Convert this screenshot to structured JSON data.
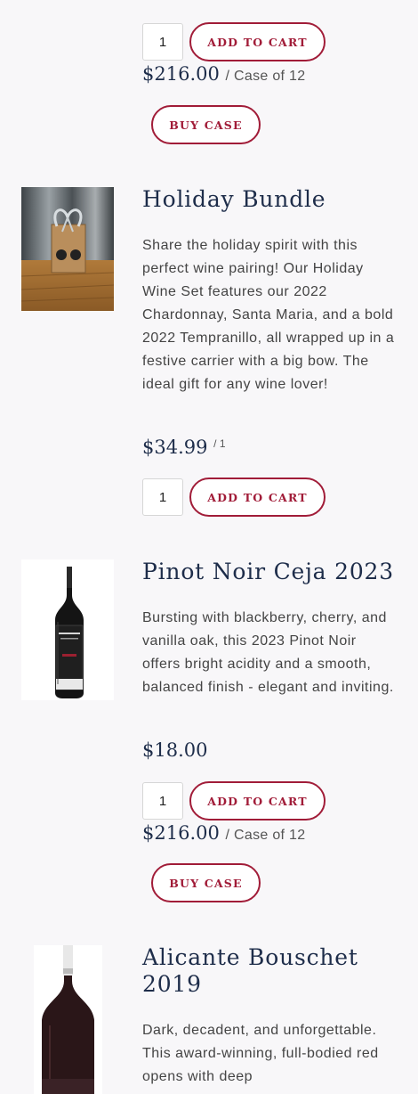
{
  "products": [
    {
      "name": "",
      "quantity": "1",
      "add_to_cart_label": "ADD TO CART",
      "case_price": "$216.00",
      "case_unit": "/ Case of 12",
      "buy_case_label": "BUY CASE"
    },
    {
      "name": "Holiday Bundle",
      "description": "Share the holiday spirit with this perfect wine pairing! Our Holiday Wine Set features our 2022 Chardonnay, Santa Maria, and a bold 2022 Tempranillo, all wrapped up in a festive carrier with a big bow. The ideal gift for any wine lover!",
      "price": "$34.99",
      "price_unit": "/ 1",
      "quantity": "1",
      "add_to_cart_label": "ADD TO CART"
    },
    {
      "name": "Pinot Noir Ceja 2023",
      "description": "Bursting with blackberry, cherry, and vanilla oak, this 2023 Pinot Noir offers bright acidity and a smooth, balanced finish - elegant and inviting.",
      "price": "$18.00",
      "quantity": "1",
      "add_to_cart_label": "ADD TO CART",
      "case_price": "$216.00",
      "case_unit": "/ Case of 12",
      "buy_case_label": "BUY CASE"
    },
    {
      "name": "Alicante Bouschet 2019",
      "description": "Dark, decadent, and unforgettable. This award-winning, full-bodied red opens with deep"
    }
  ],
  "colors": {
    "accent": "#a11c38",
    "title": "#1e2d4a",
    "background": "#f8f7f9"
  }
}
